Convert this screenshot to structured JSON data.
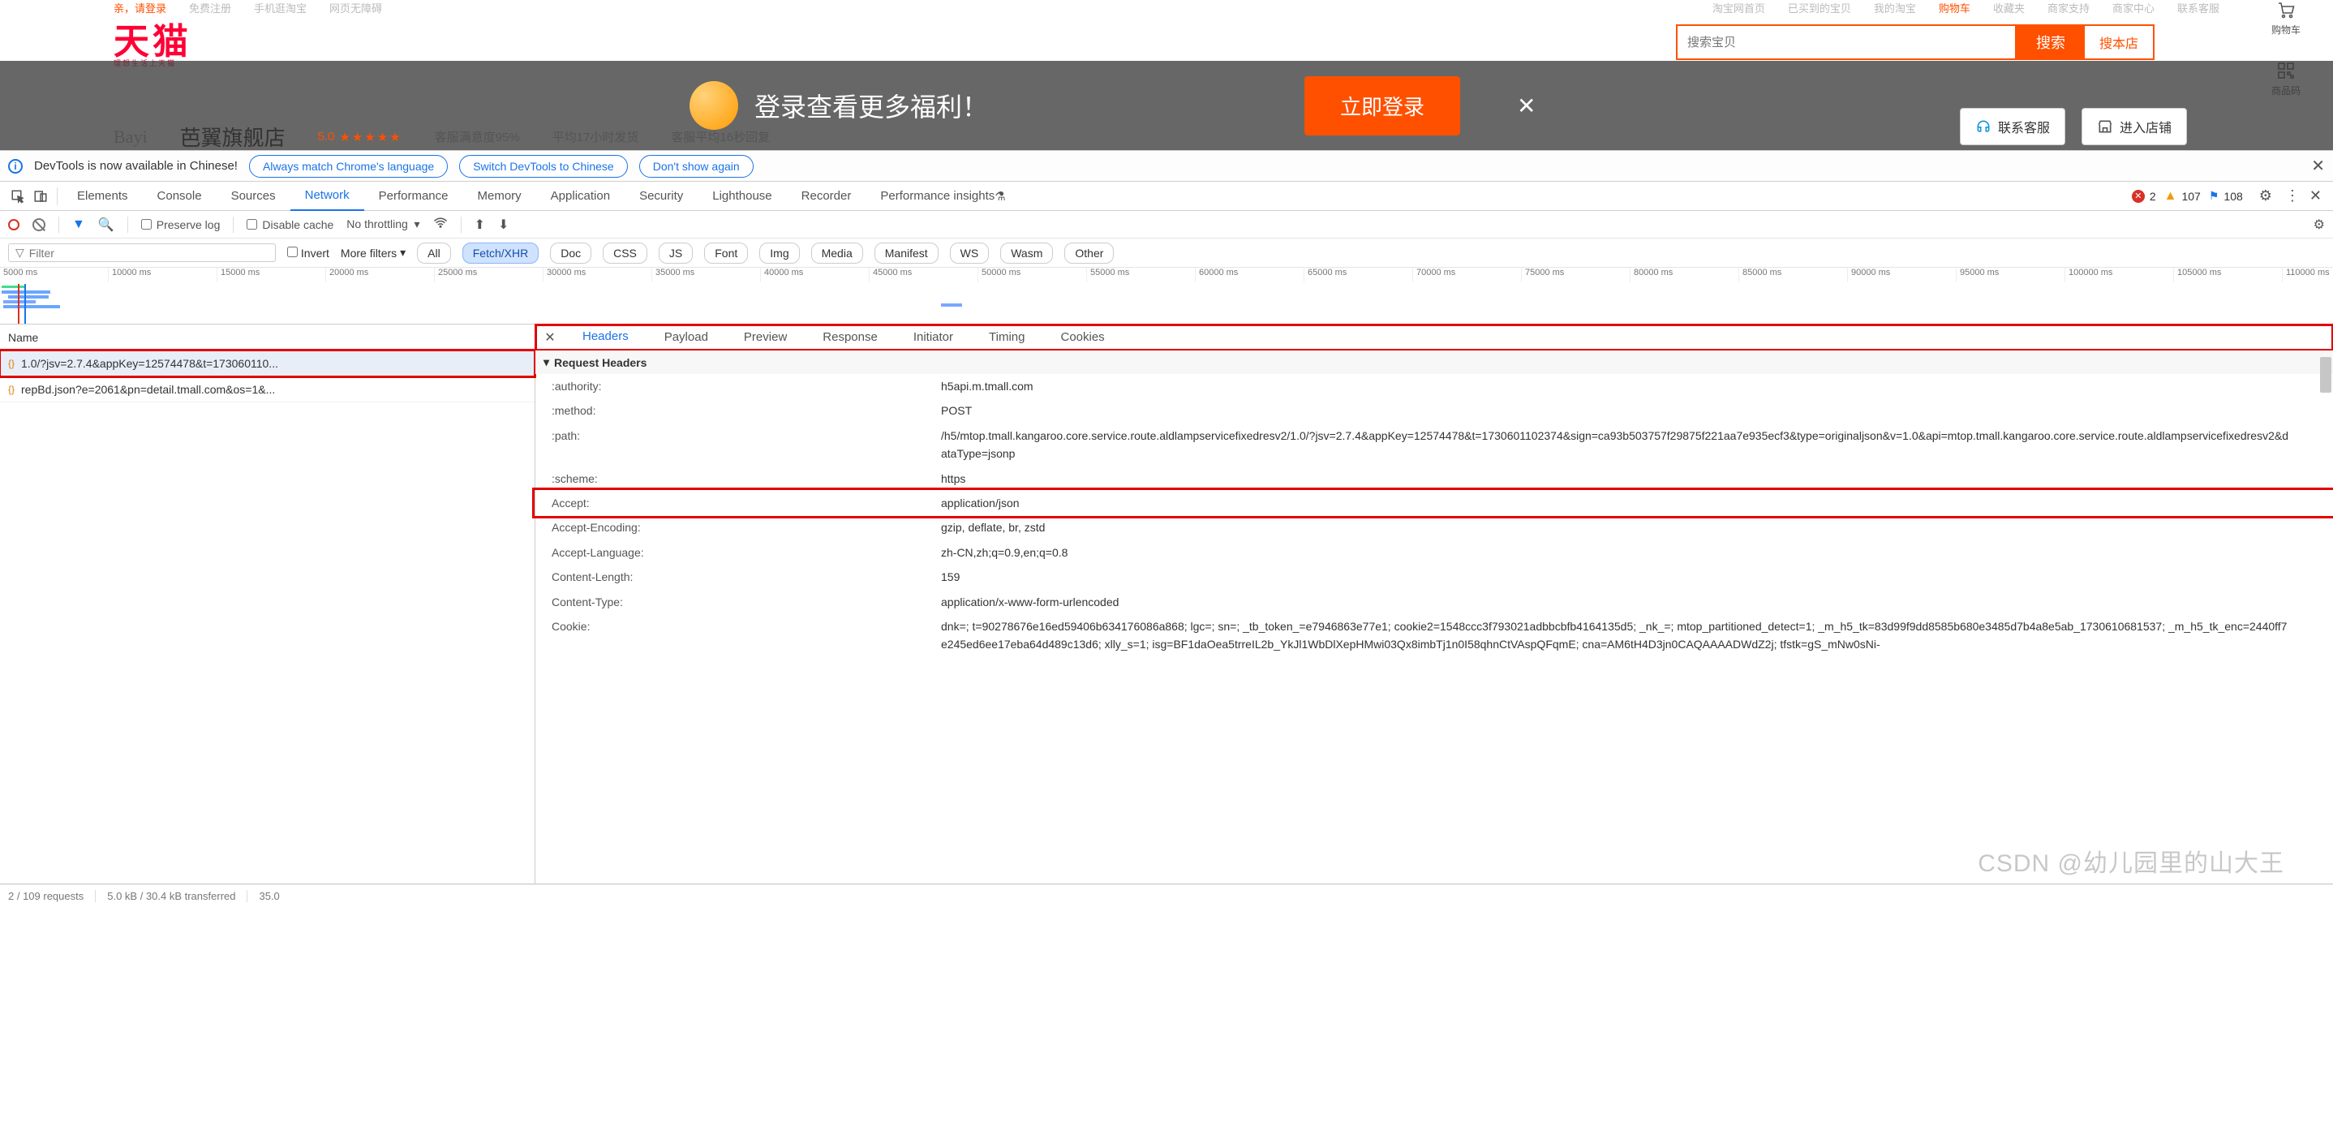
{
  "top_nav": {
    "left": [
      "亲，请登录",
      "免费注册",
      "手机逛淘宝",
      "网页无障碍"
    ],
    "right": [
      "淘宝网首页",
      "已买到的宝贝",
      "我的淘宝",
      "购物车",
      "收藏夹",
      "商家支持",
      "商家中心",
      "联系客服"
    ]
  },
  "tmall": {
    "logo": "天猫",
    "logo_sub": "理想生活上天猫"
  },
  "search": {
    "placeholder": "搜索宝贝",
    "btn": "搜索",
    "btn_shop": "搜本店"
  },
  "right_tools": {
    "cart": "购物车",
    "qrcode": "商品码"
  },
  "login_banner": {
    "msg": "登录查看更多福利！",
    "btn": "立即登录"
  },
  "shop": {
    "logo_text": "Bayi",
    "name": "芭翼旗舰店",
    "rating_value": "5.0",
    "stars": "★★★★★",
    "metric1": "客服满意度95%",
    "metric2": "平均17小时发货",
    "metric3": "客服平均16秒回复",
    "btn_contact": "联系客服",
    "btn_enter": "进入店铺"
  },
  "devtools": {
    "info_msg": "DevTools is now available in Chinese!",
    "btn_always": "Always match Chrome's language",
    "btn_switch": "Switch DevTools to Chinese",
    "btn_dont": "Don't show again",
    "panels": [
      "Elements",
      "Console",
      "Sources",
      "Network",
      "Performance",
      "Memory",
      "Application",
      "Security",
      "Lighthouse",
      "Recorder",
      "Performance insights"
    ],
    "active_panel": "Network",
    "errors_count": "2",
    "warnings_count": "107",
    "issues_count": "108",
    "toolbar": {
      "preserve": "Preserve log",
      "disable_cache": "Disable cache",
      "throttle": "No throttling"
    },
    "filter": {
      "placeholder": "Filter",
      "invert": "Invert",
      "more": "More filters",
      "types": [
        "All",
        "Fetch/XHR",
        "Doc",
        "CSS",
        "JS",
        "Font",
        "Img",
        "Media",
        "Manifest",
        "WS",
        "Wasm",
        "Other"
      ],
      "active_type": "Fetch/XHR"
    },
    "timeline_ticks": [
      "5000 ms",
      "10000 ms",
      "15000 ms",
      "20000 ms",
      "25000 ms",
      "30000 ms",
      "35000 ms",
      "40000 ms",
      "45000 ms",
      "50000 ms",
      "55000 ms",
      "60000 ms",
      "65000 ms",
      "70000 ms",
      "75000 ms",
      "80000 ms",
      "85000 ms",
      "90000 ms",
      "95000 ms",
      "100000 ms",
      "105000 ms",
      "110000 ms"
    ],
    "request_list": {
      "header": "Name",
      "items": [
        "1.0/?jsv=2.7.4&appKey=12574478&t=173060110...",
        "repBd.json?e=2061&pn=detail.tmall.com&os=1&..."
      ],
      "selected_index": 0
    },
    "detail_tabs": [
      "Headers",
      "Payload",
      "Preview",
      "Response",
      "Initiator",
      "Timing",
      "Cookies"
    ],
    "active_detail_tab": "Headers",
    "section_label": "Request Headers",
    "headers": [
      {
        "k": ":authority:",
        "v": "h5api.m.tmall.com"
      },
      {
        "k": ":method:",
        "v": "POST"
      },
      {
        "k": ":path:",
        "v": "/h5/mtop.tmall.kangaroo.core.service.route.aldlampservicefixedresv2/1.0/?jsv=2.7.4&appKey=12574478&t=1730601102374&sign=ca93b503757f29875f221aa7e935ecf3&type=originaljson&v=1.0&api=mtop.tmall.kangaroo.core.service.route.aldlampservicefixedresv2&dataType=jsonp"
      },
      {
        "k": ":scheme:",
        "v": "https"
      },
      {
        "k": "Accept:",
        "v": "application/json"
      },
      {
        "k": "Accept-Encoding:",
        "v": "gzip, deflate, br, zstd"
      },
      {
        "k": "Accept-Language:",
        "v": "zh-CN,zh;q=0.9,en;q=0.8"
      },
      {
        "k": "Content-Length:",
        "v": "159"
      },
      {
        "k": "Content-Type:",
        "v": "application/x-www-form-urlencoded"
      },
      {
        "k": "Cookie:",
        "v": "dnk=; t=90278676e16ed59406b634176086a868; lgc=; sn=; _tb_token_=e7946863e77e1; cookie2=1548ccc3f793021adbbcbfb4164135d5; _nk_=; mtop_partitioned_detect=1; _m_h5_tk=83d99f9dd8585b680e3485d7b4a8e5ab_1730610681537; _m_h5_tk_enc=2440ff7e245ed6ee17eba64d489c13d6; xlly_s=1; isg=BF1daOea5trreIL2b_YkJl1WbDlXepHMwi03Qx8imbTj1n0I58qhnCtVAspQFqmE; cna=AM6tH4D3jn0CAQAAAADWdZ2j; tfstk=gS_mNw0sNi-"
      }
    ],
    "status_bar": {
      "requests": "2 / 109 requests",
      "transfer": "5.0 kB / 30.4 kB transferred",
      "resources": "35.0"
    },
    "watermark": "CSDN @幼儿园里的山大王"
  }
}
